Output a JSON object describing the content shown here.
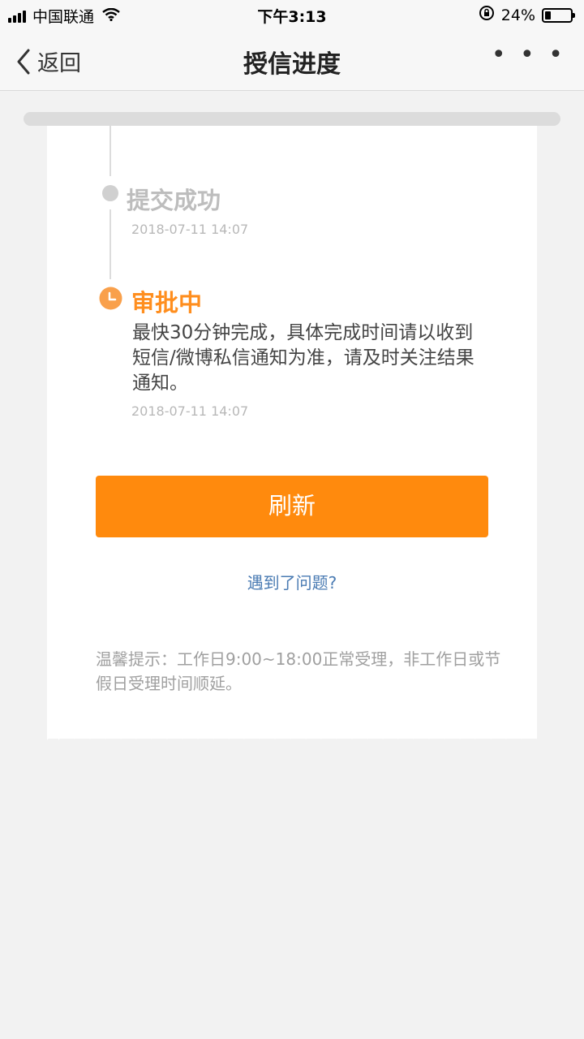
{
  "status_bar": {
    "carrier": "中国联通",
    "time": "下午3:13",
    "battery": "24%",
    "battery_level": 0.24
  },
  "nav": {
    "back_label": "返回",
    "title": "授信进度",
    "more_label": "• • •"
  },
  "timeline": {
    "steps": [
      {
        "title": "提交成功",
        "time": "2018-07-11 14:07"
      },
      {
        "title": "审批中",
        "description": "最快30分钟完成，具体完成时间请以收到短信/微博私信通知为准，请及时关注结果通知。",
        "time": "2018-07-11 14:07"
      }
    ]
  },
  "actions": {
    "refresh_label": "刷新",
    "problem_link": "遇到了问题?"
  },
  "tip": "温馨提示：工作日9:00~18:00正常受理，非工作日或节假日受理时间顺延。",
  "colors": {
    "accent": "#ff8a0d",
    "link": "#4a7bb3",
    "muted": "#bdbdbd"
  }
}
